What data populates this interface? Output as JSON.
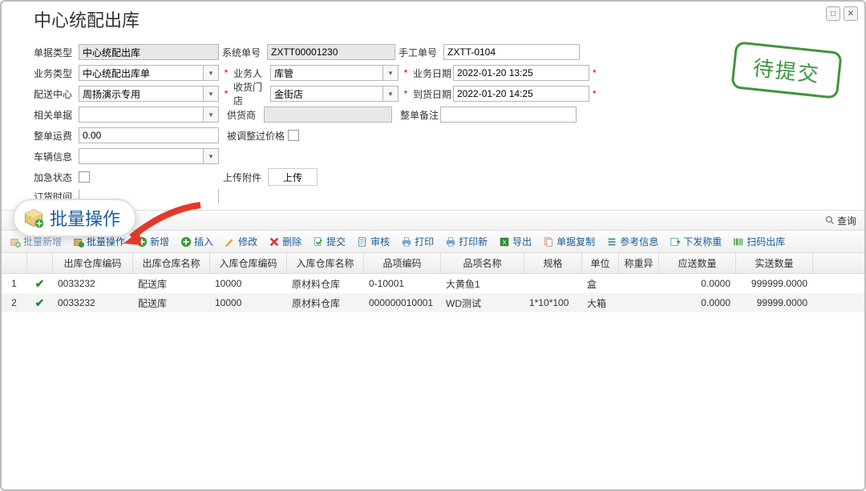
{
  "title": "中心统配出库",
  "winControls": {
    "min": "□",
    "close": "✕"
  },
  "stamp": "待提交",
  "form": {
    "docTypeLabel": "单据类型",
    "docTypeValue": "中心统配出库",
    "sysNoLabel": "系统单号",
    "sysNoValue": "ZXTT00001230",
    "manualNoLabel": "手工单号",
    "manualNoValue": "ZXTT-0104",
    "bizTypeLabel": "业务类型",
    "bizTypeValue": "中心统配出库单",
    "operatorLabel": "业务人",
    "operatorValue": "库管",
    "bizDateLabel": "业务日期",
    "bizDateValue": "2022-01-20 13:25",
    "centerLabel": "配送中心",
    "centerValue": "周扬演示专用",
    "recvStoreLabel": "收货门店",
    "recvStoreValue": "金街店",
    "arriveDateLabel": "到货日期",
    "arriveDateValue": "2022-01-20 14:25",
    "relDocLabel": "相关单据",
    "relDocValue": "",
    "supplierLabel": "供货商",
    "supplierValue": "",
    "wholeRemarkLabel": "整单备注",
    "wholeRemarkValue": "",
    "freightLabel": "整单运费",
    "freightValue": "0.00",
    "adjPriceLabel": "被调整过价格",
    "vehicleLabel": "车辆信息",
    "vehicleValue": "",
    "urgentLabel": "加急状态",
    "attachLabel": "上传附件",
    "uploadBtn": "上传",
    "orderTimeLabel": "订货时间",
    "orderTimeValue": ""
  },
  "searchBtn": "查询",
  "callout": "批量操作",
  "toolbar": {
    "batchNew": "批量新增",
    "batchOp": "批量操作",
    "new": "新增",
    "insert": "插入",
    "edit": "修改",
    "delete": "删除",
    "submit": "提交",
    "audit": "审核",
    "print": "打印",
    "printNew": "打印新",
    "export": "导出",
    "docCopy": "单据复制",
    "refInfo": "参考信息",
    "sendWeigh": "下发称重",
    "scanOut": "扫码出库"
  },
  "columns": [
    "",
    "",
    "出库仓库编码",
    "出库仓库名称",
    "入库仓库编码",
    "入库仓库名称",
    "品项编码",
    "品项名称",
    "规格",
    "单位",
    "称重异",
    "应送数量",
    "实送数量"
  ],
  "rows": [
    {
      "idx": "1",
      "outCode": "0033232",
      "outName": "配送库",
      "inCode": "10000",
      "inName": "原材料仓库",
      "itemCode": "0-10001",
      "itemName": "大黄鱼1",
      "spec": "",
      "unit": "盒",
      "weighDiff": "",
      "planQty": "0.0000",
      "actualQty": "999999.0000"
    },
    {
      "idx": "2",
      "outCode": "0033232",
      "outName": "配送库",
      "inCode": "10000",
      "inName": "原材料仓库",
      "itemCode": "000000010001",
      "itemName": "WD测试",
      "spec": "1*10*100",
      "unit": "大箱",
      "weighDiff": "",
      "planQty": "0.0000",
      "actualQty": "99999.0000"
    }
  ]
}
